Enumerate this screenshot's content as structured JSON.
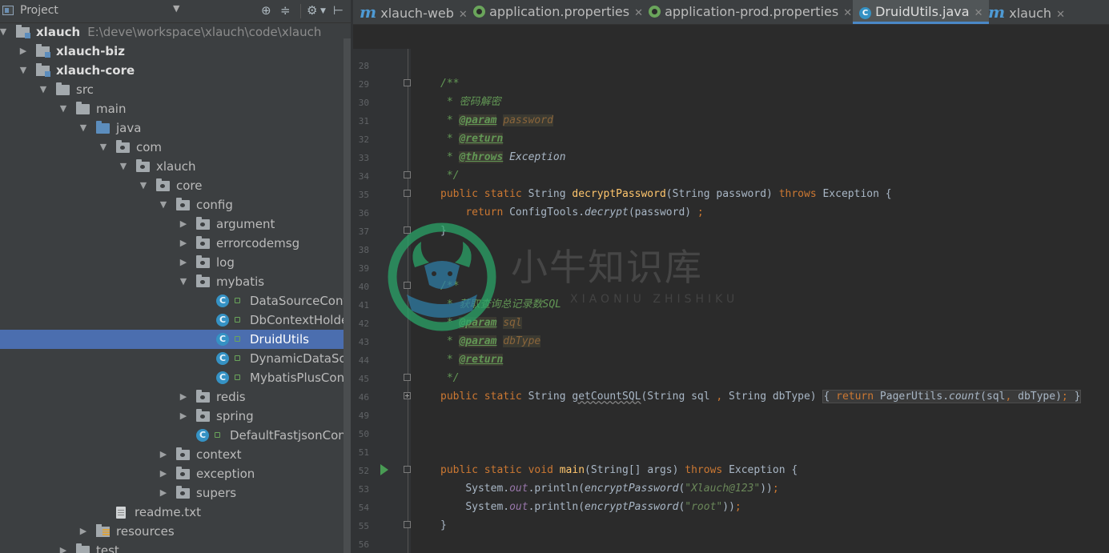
{
  "project_panel": {
    "title": "Project",
    "tree": [
      {
        "label": "xlauch",
        "path": "E:\\deve\\workspace\\xlauch\\code\\xlauch",
        "bold": true,
        "depth": 0,
        "expanded": true,
        "icon": "module-icon"
      },
      {
        "label": "xlauch-biz",
        "bold": true,
        "depth": 1,
        "expanded": false,
        "icon": "module-icon"
      },
      {
        "label": "xlauch-core",
        "bold": true,
        "depth": 1,
        "expanded": true,
        "icon": "module-icon"
      },
      {
        "label": "src",
        "depth": 2,
        "expanded": true,
        "icon": "folder-icon"
      },
      {
        "label": "main",
        "depth": 3,
        "expanded": true,
        "icon": "folder-icon"
      },
      {
        "label": "java",
        "depth": 4,
        "expanded": true,
        "icon": "source-folder-icon"
      },
      {
        "label": "com",
        "depth": 5,
        "expanded": true,
        "icon": "package-icon"
      },
      {
        "label": "xlauch",
        "depth": 6,
        "expanded": true,
        "icon": "package-icon"
      },
      {
        "label": "core",
        "depth": 7,
        "expanded": true,
        "icon": "package-icon"
      },
      {
        "label": "config",
        "depth": 8,
        "expanded": true,
        "icon": "package-icon"
      },
      {
        "label": "argument",
        "depth": 9,
        "expanded": false,
        "icon": "package-icon"
      },
      {
        "label": "errorcodemsg",
        "depth": 9,
        "expanded": false,
        "icon": "package-icon"
      },
      {
        "label": "log",
        "depth": 9,
        "expanded": false,
        "icon": "package-icon"
      },
      {
        "label": "mybatis",
        "depth": 9,
        "expanded": true,
        "icon": "package-icon"
      },
      {
        "label": "DataSourceConfig",
        "depth": 10,
        "icon": "class-icon"
      },
      {
        "label": "DbContextHolder",
        "depth": 10,
        "icon": "class-icon"
      },
      {
        "label": "DruidUtils",
        "depth": 10,
        "icon": "class-icon",
        "selected": true
      },
      {
        "label": "DynamicDataSource",
        "depth": 10,
        "icon": "class-icon"
      },
      {
        "label": "MybatisPlusConfig",
        "depth": 10,
        "icon": "class-icon"
      },
      {
        "label": "redis",
        "depth": 9,
        "expanded": false,
        "icon": "package-icon"
      },
      {
        "label": "spring",
        "depth": 9,
        "expanded": false,
        "icon": "package-icon"
      },
      {
        "label": "DefaultFastjsonConfig",
        "depth": 9,
        "icon": "class-icon"
      },
      {
        "label": "context",
        "depth": 8,
        "expanded": false,
        "icon": "package-icon"
      },
      {
        "label": "exception",
        "depth": 8,
        "expanded": false,
        "icon": "package-icon"
      },
      {
        "label": "supers",
        "depth": 8,
        "expanded": false,
        "icon": "package-icon"
      },
      {
        "label": "readme.txt",
        "depth": 5,
        "icon": "text-file-icon"
      },
      {
        "label": "resources",
        "depth": 4,
        "expanded": false,
        "icon": "resources-folder-icon"
      },
      {
        "label": "test",
        "depth": 3,
        "expanded": false,
        "icon": "folder-icon"
      }
    ]
  },
  "tabs": [
    {
      "label": "xlauch-web",
      "icon": "maven-icon",
      "closable": true,
      "active": false
    },
    {
      "label": "application.properties",
      "icon": "spring-icon",
      "closable": true,
      "active": false
    },
    {
      "label": "application-prod.properties",
      "icon": "spring-icon",
      "closable": true,
      "active": false
    },
    {
      "label": "DruidUtils.java",
      "icon": "class-icon",
      "closable": true,
      "active": true
    },
    {
      "label": "xlauch",
      "icon": "maven-icon",
      "closable": true,
      "active": false
    }
  ],
  "tab_icon_glyphs": {
    "maven": "m",
    "class": "C",
    "close": "✕"
  },
  "line_numbers": [
    "28",
    "29",
    "30",
    "31",
    "32",
    "33",
    "34",
    "35",
    "36",
    "37",
    "38",
    "39",
    "40",
    "41",
    "42",
    "43",
    "44",
    "45",
    "46",
    "49",
    "50",
    "51",
    "52",
    "53",
    "54",
    "55",
    "56"
  ],
  "code": {
    "doc_open": "/**",
    "doc_star": "* ",
    "doc_close": "*/",
    "doc1_desc": "密码解密",
    "tag_param": "@param",
    "tag_return": "@return",
    "tag_throws": "@throws",
    "param_password": "password",
    "exception_word": "Exception",
    "kw_public": "public",
    "kw_static": "static",
    "kw_void": "void",
    "kw_return": "return",
    "kw_throws": "throws",
    "type_string": "String",
    "m1_name": "decryptPassword",
    "m1_params": "(String password) ",
    "m1_tail": "Exception {",
    "m1_body_call": "ConfigTools.",
    "m1_body_method": "decrypt",
    "m1_body_args": "(password) ",
    "m1_body_semi": ";",
    "close_brace": "}",
    "doc2_desc_cn": "获取查询总记录数",
    "doc2_desc_sql": "SQL",
    "param_sql": "sql",
    "param_dbtype": "dbType",
    "m2_name": "getCountSQL",
    "m2_params": "(String sql ",
    "m2_comma": ",",
    "m2_params2": " String dbType) ",
    "m2_open": "{ ",
    "m2_call": "PagerUtils.",
    "m2_method": "count",
    "m2_args1": "(sql",
    "m2_args2": " dbType)",
    "m2_close": " }",
    "m3_name": "main",
    "m3_params": "(String[] args) ",
    "sys_out": "System.",
    "out_field": "out",
    "println_open": ".println(",
    "encrypt_call": "encryptPassword",
    "str1": "\"Xlauch@123\"",
    "str2": "\"root\"",
    "call_close": "))",
    "semi": ";"
  },
  "watermark": {
    "text": "小牛知识库",
    "subtext": "XIAONIU ZHISHIKU"
  },
  "colors": {
    "background": "#2b2b2b",
    "panel": "#3c3f41",
    "selection": "#4b6eaf",
    "keyword": "#cc7832",
    "method": "#ffc66d",
    "doc_comment": "#629755",
    "string": "#6a8759",
    "field": "#9876aa"
  }
}
